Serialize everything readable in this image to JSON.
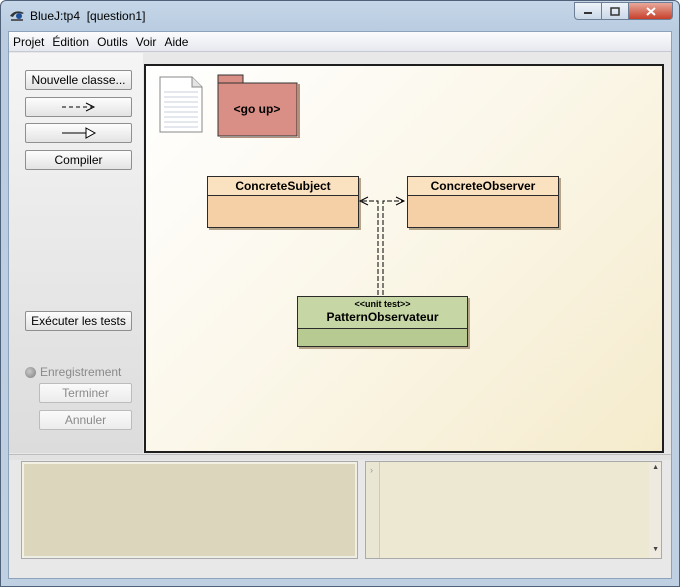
{
  "window": {
    "title": "BlueJ:tp4  [question1]",
    "controls": {
      "minimize": "minimize-icon",
      "maximize": "maximize-icon",
      "close": "close-icon"
    }
  },
  "menu": [
    "Projet",
    "Édition",
    "Outils",
    "Voir",
    "Aide"
  ],
  "toolbar": {
    "new_class": "Nouvelle classe...",
    "uses_arrow_icon": "dashed-arrow-icon",
    "inherits_arrow_icon": "inheritance-arrow-icon",
    "compile": "Compiler",
    "run_tests": "Exécuter les tests",
    "recording": "Enregistrement",
    "end": "Terminer",
    "cancel": "Annuler"
  },
  "diagram": {
    "readme_icon": "document-icon",
    "package_up": "<go up>",
    "classes": {
      "subject": "ConcreteSubject",
      "observer": "ConcreteObserver",
      "test_stereotype": "<<unit test>>",
      "test": "PatternObservateur"
    }
  },
  "colors": {
    "class_fill": "#f5d0a7",
    "test_fill": "#b7ca92",
    "package_fill": "#d98f86",
    "canvas_tint": "#f5ebcc"
  }
}
